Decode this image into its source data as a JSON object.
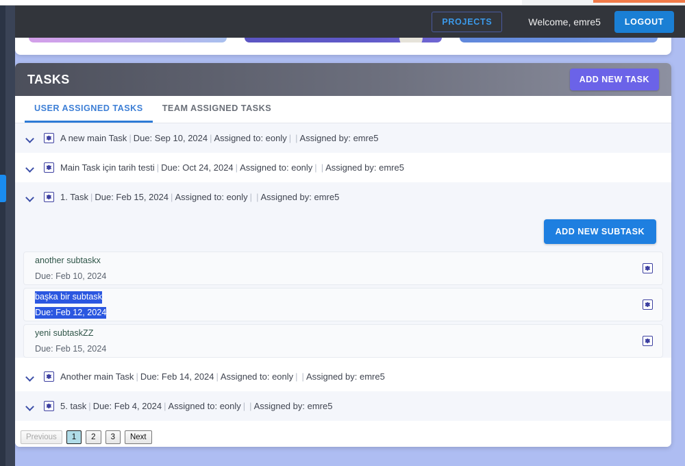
{
  "navbar": {
    "projects_label": "PROJECTS",
    "welcome_text": "Welcome, emre5",
    "logout_label": "LOGOUT"
  },
  "tasks_panel": {
    "title": "TASKS",
    "add_task_label": "ADD NEW TASK",
    "accent_color": "#6b63e8",
    "tabs": [
      {
        "label": "USER ASSIGNED TASKS",
        "active": true
      },
      {
        "label": "TEAM ASSIGNED TASKS",
        "active": false
      }
    ]
  },
  "tasks": [
    {
      "name": "A new main Task",
      "due": "Due: Sep 10, 2024",
      "assigned_to": "Assigned to: eonly",
      "assigned_by": "Assigned by: emre5"
    },
    {
      "name": "Main Task için tarih testi",
      "due": "Due: Oct 24, 2024",
      "assigned_to": "Assigned to: eonly",
      "assigned_by": "Assigned by: emre5"
    },
    {
      "name": "1. Task",
      "due": "Due: Feb 15, 2024",
      "assigned_to": "Assigned to: eonly",
      "assigned_by": "Assigned by: emre5"
    },
    {
      "name": "Another main Task",
      "due": "Due: Feb 14, 2024",
      "assigned_to": "Assigned to: eonly",
      "assigned_by": "Assigned by: emre5"
    },
    {
      "name": "5. task",
      "due": "Due: Feb 4, 2024",
      "assigned_to": "Assigned to: eonly",
      "assigned_by": "Assigned by: emre5"
    }
  ],
  "subtask_section": {
    "add_subtask_label": "ADD NEW SUBTASK",
    "add_subtask_color": "#1e7fe0",
    "selection_highlight_color": "#2b57e0",
    "items": [
      {
        "name": "another subtaskx",
        "due": "Due: Feb 10, 2024",
        "selected": false
      },
      {
        "name": "başka bir subtask",
        "due": "Due: Feb 12, 2024",
        "selected": true
      },
      {
        "name": "yeni subtaskZZ",
        "due": "Due: Feb 15, 2024",
        "selected": false
      }
    ]
  },
  "pagination": {
    "previous_label": "Previous",
    "pages": [
      "1",
      "2",
      "3"
    ],
    "next_label": "Next",
    "current_page": "1"
  },
  "separators": {
    "pipe": "|"
  }
}
